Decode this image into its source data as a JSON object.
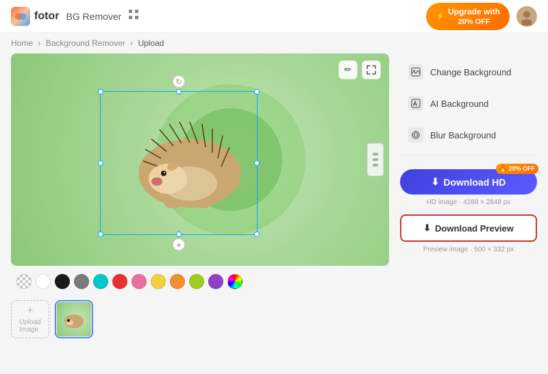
{
  "header": {
    "logo_text": "fotor",
    "tool_name": "BG Remover",
    "upgrade_label": "Upgrade with",
    "upgrade_discount": "20% OFF"
  },
  "breadcrumb": {
    "home": "Home",
    "bg_remover": "Background Remover",
    "current": "Upload"
  },
  "canvas": {
    "tool_pencil": "✏",
    "tool_expand": "✕"
  },
  "swatches": [
    {
      "color": "checker",
      "label": "transparent"
    },
    {
      "color": "#ffffff",
      "label": "white"
    },
    {
      "color": "#1a1a1a",
      "label": "black"
    },
    {
      "color": "#7a7a7a",
      "label": "gray"
    },
    {
      "color": "#00c8c8",
      "label": "cyan"
    },
    {
      "color": "#e83030",
      "label": "red"
    },
    {
      "color": "#e870a0",
      "label": "pink"
    },
    {
      "color": "#f0d040",
      "label": "yellow"
    },
    {
      "color": "#f09030",
      "label": "orange"
    },
    {
      "color": "#a0cc20",
      "label": "lime"
    },
    {
      "color": "#9040c8",
      "label": "purple"
    },
    {
      "color": "rainbow",
      "label": "rainbow"
    }
  ],
  "panel": {
    "change_bg_label": "Change Background",
    "ai_bg_label": "AI Background",
    "blur_bg_label": "Blur Background",
    "download_hd_label": "Download HD",
    "download_hd_badge": "🔥 20% OFF",
    "hd_info": "HD image · 4288 × 2848 px",
    "download_preview_label": "Download Preview",
    "preview_info": "Preview image · 500 × 332 px"
  },
  "thumbnail": {
    "upload_label": "Upload\nImage"
  }
}
